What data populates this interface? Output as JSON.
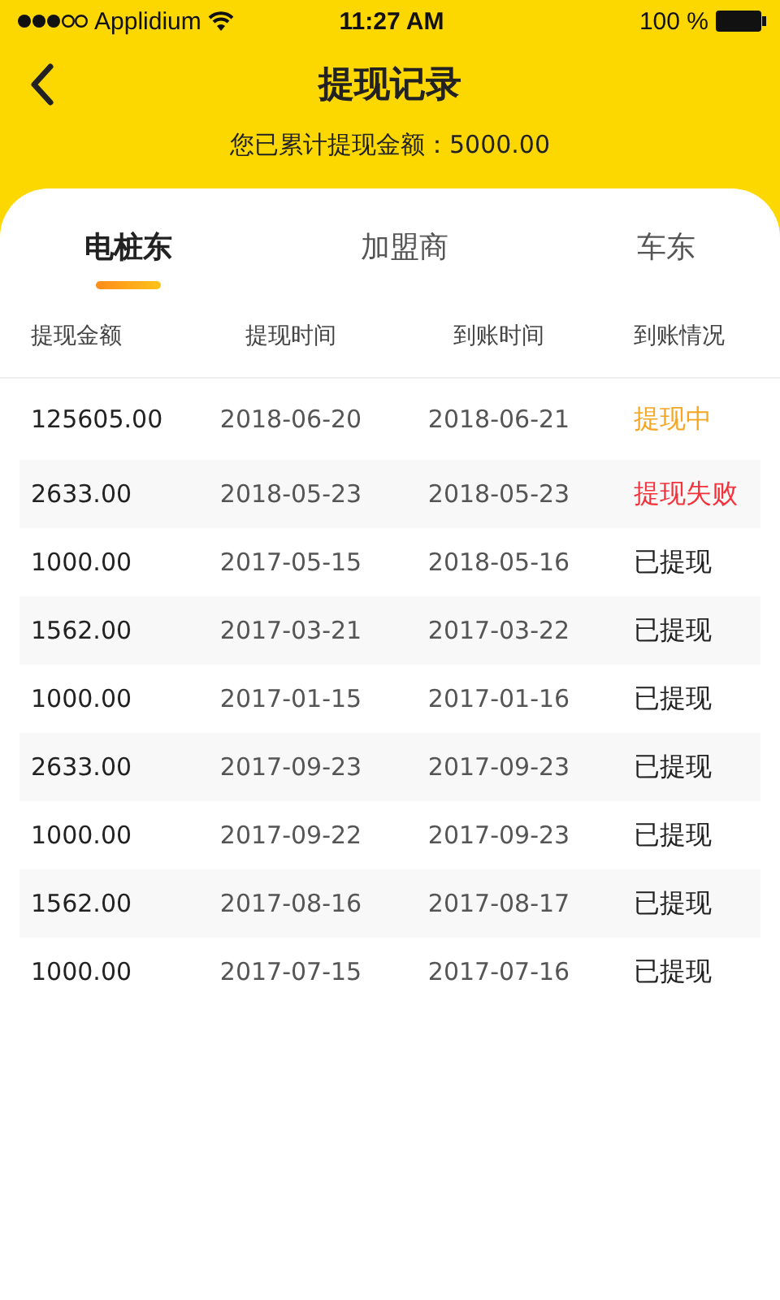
{
  "status_bar": {
    "carrier": "Applidium",
    "time": "11:27 AM",
    "battery": "100 %"
  },
  "header": {
    "title": "提现记录",
    "summary": "您已累计提现金额：5000.00"
  },
  "tabs": [
    {
      "label": "电桩东",
      "selected": true
    },
    {
      "label": "加盟商",
      "selected": false
    },
    {
      "label": "车东",
      "selected": false
    }
  ],
  "table": {
    "columns": [
      "提现金额",
      "提现时间",
      "到账时间",
      "到账情况"
    ],
    "rows": [
      {
        "amount": "125605.00",
        "applied": "2018-06-20",
        "arrived": "2018-06-21",
        "status": "提现中",
        "kind": "pending"
      },
      {
        "amount": "2633.00",
        "applied": "2018-05-23",
        "arrived": "2018-05-23",
        "status": "提现失败",
        "kind": "failed"
      },
      {
        "amount": "1000.00",
        "applied": "2017-05-15",
        "arrived": "2018-05-16",
        "status": "已提现",
        "kind": "done"
      },
      {
        "amount": "1562.00",
        "applied": "2017-03-21",
        "arrived": "2017-03-22",
        "status": "已提现",
        "kind": "done"
      },
      {
        "amount": "1000.00",
        "applied": "2017-01-15",
        "arrived": "2017-01-16",
        "status": "已提现",
        "kind": "done"
      },
      {
        "amount": "2633.00",
        "applied": "2017-09-23",
        "arrived": "2017-09-23",
        "status": "已提现",
        "kind": "done"
      },
      {
        "amount": "1000.00",
        "applied": "2017-09-22",
        "arrived": "2017-09-23",
        "status": "已提现",
        "kind": "done"
      },
      {
        "amount": "1562.00",
        "applied": "2017-08-16",
        "arrived": "2017-08-17",
        "status": "已提现",
        "kind": "done"
      },
      {
        "amount": "1000.00",
        "applied": "2017-07-15",
        "arrived": "2017-07-16",
        "status": "已提现",
        "kind": "done"
      }
    ]
  }
}
